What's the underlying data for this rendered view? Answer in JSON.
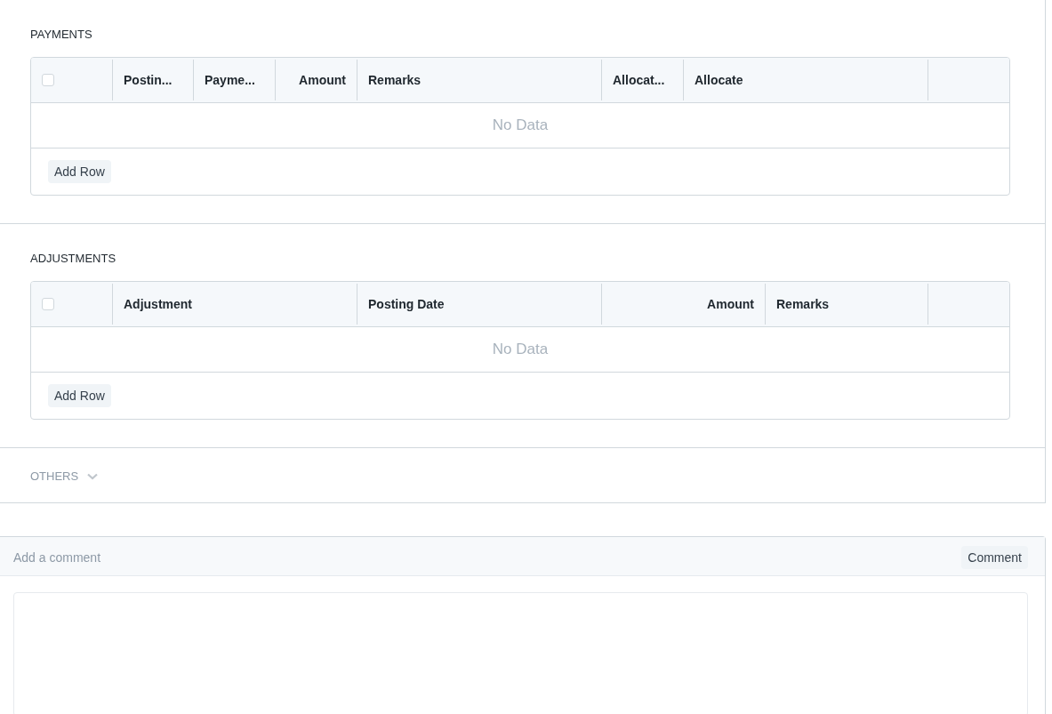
{
  "sections": [
    {
      "title": "PAYMENTS",
      "expanded": true,
      "table": {
        "select_all": {
          "checked": false
        },
        "columns": [
          {
            "label": "Postin...",
            "kind": "text"
          },
          {
            "label": "Payme...",
            "kind": "text"
          },
          {
            "label": "Amount",
            "kind": "currency"
          },
          {
            "label": "Remarks",
            "kind": "text"
          },
          {
            "label": "Allocat...",
            "kind": "text"
          },
          {
            "label": "Allocate",
            "kind": "text"
          }
        ],
        "empty_text": "No Data",
        "add_button": "Add Row"
      }
    },
    {
      "title": "ADJUSTMENTS",
      "expanded": true,
      "table": {
        "select_all": {
          "checked": false
        },
        "columns": [
          {
            "label": "Adjustment",
            "kind": "text"
          },
          {
            "label": "Posting Date",
            "kind": "text"
          },
          {
            "label": "Amount",
            "kind": "currency"
          },
          {
            "label": "Remarks",
            "kind": "text"
          }
        ],
        "empty_text": "No Data",
        "add_button": "Add Row"
      }
    },
    {
      "title": "OTHERS",
      "expanded": false
    }
  ],
  "comment": {
    "placeholder": "Add a comment",
    "button": "Comment"
  }
}
